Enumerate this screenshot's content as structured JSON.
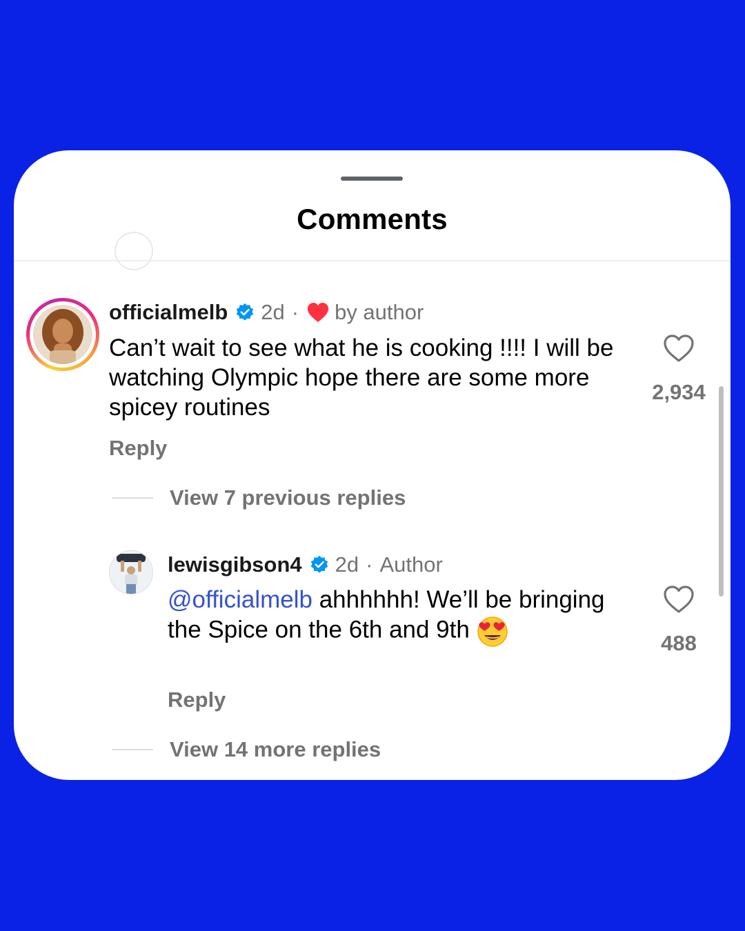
{
  "colors": {
    "background": "#0a22e6",
    "card": "#ffffff",
    "muted": "#737373",
    "mention": "#3451d1",
    "verified": "#0095f6",
    "heart": "#ff3040"
  },
  "sheet": {
    "title": "Comments"
  },
  "comments": [
    {
      "username": "officialmelb",
      "verified": true,
      "time": "2d",
      "separator": "·",
      "badge": "by author",
      "badge_icon": "heart-icon",
      "text": "Can’t wait to see what he is cooking !!!! I will be watching Olympic hope there are some more spicey routines",
      "reply_label": "Reply",
      "likes": "2,934",
      "view_replies": "View 7 previous replies"
    },
    {
      "username": "lewisgibson4",
      "verified": true,
      "time": "2d",
      "separator": "·",
      "badge": "Author",
      "mention": "@officialmelb",
      "text": " ahhhhhh! We’ll be bringing the Spice on the 6th and 9th ",
      "emoji": "heart-eyes-emoji",
      "reply_label": "Reply",
      "likes": "488",
      "view_replies": "View 14 more replies"
    }
  ]
}
